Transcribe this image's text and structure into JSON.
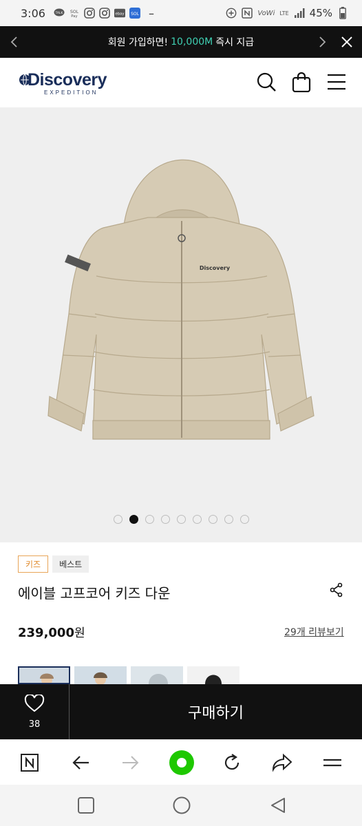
{
  "status_bar": {
    "time": "3:06",
    "notification_icons": [
      "talk-icon",
      "sol-pay-icon",
      "instagram-icon",
      "instagram-icon",
      "ebay-icon",
      "sol-icon"
    ],
    "dash": "–",
    "right_icons": [
      "add-circle-icon",
      "nfc-icon",
      "vowifi-icon",
      "lte-icon",
      "signal-icon"
    ],
    "vowifi": "VoWi",
    "lte": "LTE",
    "battery": "45%"
  },
  "promo": {
    "text_prefix": "회원 가입하면!",
    "highlight": "10,000M",
    "text_suffix": "즉시 지급",
    "accent_color": "#3fd1b4"
  },
  "header": {
    "logo_main": "Discovery",
    "logo_sub": "EXPEDITION",
    "brand_color": "#1a2e5a",
    "icons": [
      "search-icon",
      "shopping-bag-icon",
      "menu-icon"
    ]
  },
  "gallery": {
    "image_count": 9,
    "active_index": 1
  },
  "product": {
    "tags": [
      "키즈",
      "베스트"
    ],
    "title": "에이블 고프코어 키즈 다운",
    "price_number": "239,000",
    "price_unit": "원",
    "review_link": "29개 리뷰보기"
  },
  "action_bar": {
    "like_count": "38",
    "buy_label": "구매하기"
  },
  "browser": {
    "buttons": [
      "naver-icon",
      "back-arrow-icon",
      "forward-arrow-icon",
      "home-dot-icon",
      "refresh-icon",
      "share-arrow-icon",
      "hamburger-icon"
    ],
    "home_color": "#1ec800"
  },
  "nav": {
    "buttons": [
      "recents-icon",
      "home-icon",
      "back-icon"
    ]
  }
}
